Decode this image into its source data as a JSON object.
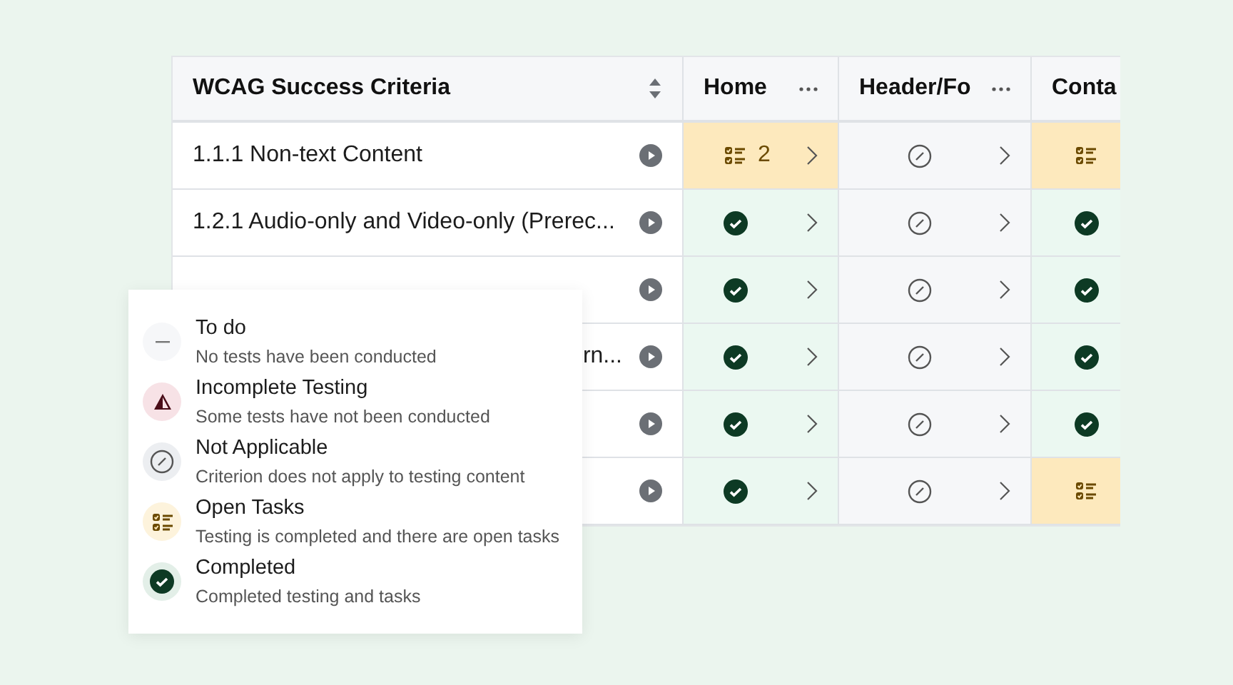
{
  "table": {
    "criteria_header": "WCAG Success Criteria",
    "columns": [
      {
        "label": "Home"
      },
      {
        "label": "Header/Fo"
      },
      {
        "label": "Conta"
      }
    ],
    "rows": [
      {
        "criterion": "1.1.1 Non-text Content",
        "cells": [
          {
            "kind": "open_tasks",
            "count": "2"
          },
          {
            "kind": "not_applicable"
          },
          {
            "kind": "open_tasks"
          }
        ]
      },
      {
        "criterion": "1.2.1 Audio-only and Video-only (Prerec...",
        "cells": [
          {
            "kind": "completed"
          },
          {
            "kind": "not_applicable"
          },
          {
            "kind": "completed"
          }
        ]
      },
      {
        "cells": [
          {
            "kind": "completed"
          },
          {
            "kind": "not_applicable"
          },
          {
            "kind": "completed"
          }
        ]
      },
      {
        "criterion": "rn...",
        "kind": "partial",
        "cells": [
          {
            "kind": "completed"
          },
          {
            "kind": "not_applicable"
          },
          {
            "kind": "completed"
          }
        ]
      },
      {
        "cells": [
          {
            "kind": "completed"
          },
          {
            "kind": "not_applicable"
          },
          {
            "kind": "completed"
          }
        ]
      },
      {
        "cells": [
          {
            "kind": "completed"
          },
          {
            "kind": "not_applicable"
          },
          {
            "kind": "open_tasks"
          }
        ]
      }
    ]
  },
  "legend": [
    {
      "kind": "todo",
      "title": "To do",
      "description": "No tests have been conducted"
    },
    {
      "kind": "incomplete",
      "title": "Incomplete Testing",
      "description": "Some tests have not been conducted"
    },
    {
      "kind": "not_applicable",
      "title": "Not Applicable",
      "description": "Criterion does not apply to testing content"
    },
    {
      "kind": "open_tasks",
      "title": "Open Tasks",
      "description": "Testing is completed and there are open tasks"
    },
    {
      "kind": "completed",
      "title": "Completed",
      "description": "Completed testing and tasks"
    }
  ]
}
